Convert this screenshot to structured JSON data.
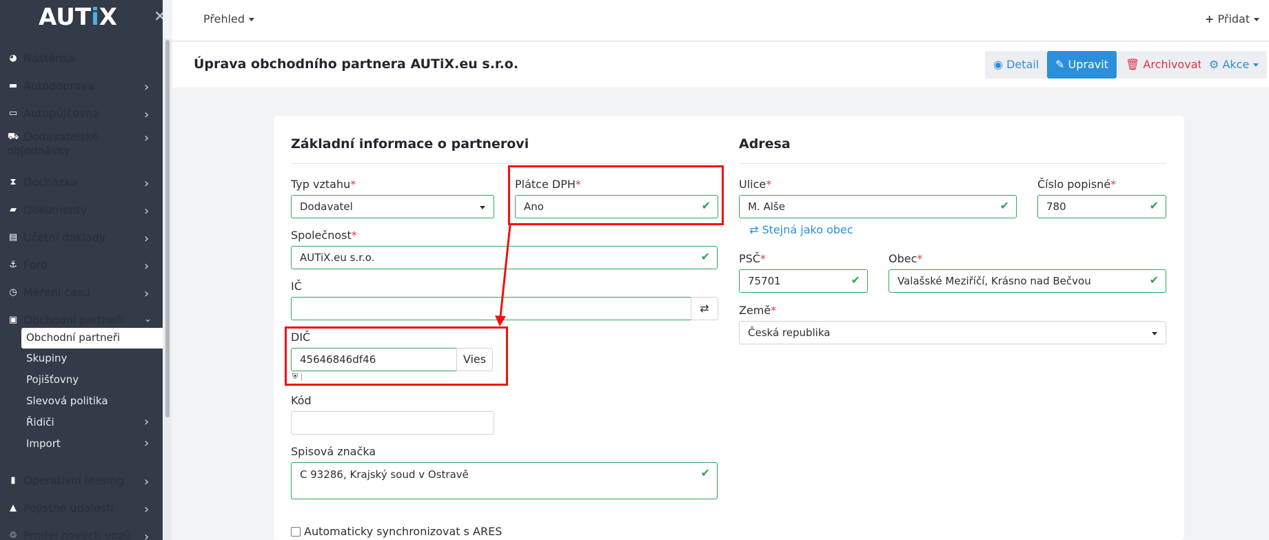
{
  "sidebar": {
    "logo": {
      "pre": "AUT",
      "i": "i",
      "post": "X"
    },
    "items": [
      {
        "label": "Nástěnka",
        "icon": "dashboard-icon",
        "glyph": "◕",
        "chevron": false
      },
      {
        "label": "Autodoprava",
        "icon": "truck-icon",
        "glyph": "▬",
        "chevron": true
      },
      {
        "label": "Autopůjčovna",
        "icon": "id-card-icon",
        "glyph": "▭",
        "chevron": true
      },
      {
        "label": "Dodavatelské",
        "label2": "objednávky",
        "icon": "cart-icon",
        "glyph": "⛟",
        "chevron": true
      },
      {
        "label": "Docházka",
        "icon": "hourglass-icon",
        "glyph": "⧗",
        "chevron": true
      },
      {
        "label": "Dokumenty",
        "icon": "folder-icon",
        "glyph": "▰",
        "chevron": true
      },
      {
        "label": "Účetní doklady",
        "icon": "file-icon",
        "glyph": "▤",
        "chevron": true
      },
      {
        "label": "Ford",
        "icon": "anchor-icon",
        "glyph": "⚓",
        "chevron": true
      },
      {
        "label": "Měření času",
        "icon": "clock-icon",
        "glyph": "◷",
        "chevron": true
      },
      {
        "label": "Obchodní partneři",
        "icon": "briefcase-icon",
        "glyph": "▣",
        "chevron": true,
        "expanded": true
      },
      {
        "label": "Operativní leasing",
        "icon": "book-icon",
        "glyph": "▮",
        "chevron": true
      },
      {
        "label": "Pojistné události",
        "icon": "warning-icon",
        "glyph": "▲",
        "chevron": true
      },
      {
        "label": "Prodej nových vozů",
        "icon": "handshake-icon",
        "glyph": "♲",
        "chevron": true
      }
    ],
    "subitems": [
      {
        "label": "Obchodní partneři",
        "active": true
      },
      {
        "label": "Skupiny"
      },
      {
        "label": "Pojišťovny"
      },
      {
        "label": "Slevová politika"
      },
      {
        "label": "Řidiči",
        "chevron": true
      },
      {
        "label": "Import",
        "chevron": true
      }
    ]
  },
  "topbar": {
    "overview": "Přehled",
    "add": "Přidat"
  },
  "title": "Úprava obchodního partnera AUTiX.eu s.r.o.",
  "actions": {
    "detail": "Detail",
    "edit": "Upravit",
    "archive": "Archivovat",
    "more": "Akce"
  },
  "form": {
    "basic_title": "Základní informace o partnerovi",
    "typ_label": "Typ vztahu",
    "typ_value": "Dodavatel",
    "platce_label": "Plátce DPH",
    "platce_value": "Ano",
    "spolecnost_label": "Společnost",
    "spolecnost_value": "AUTiX.eu s.r.o.",
    "ic_label": "IČ",
    "ic_value": "",
    "dic_label": "DIČ",
    "dic_value": "45646846df46",
    "vies_label": "Vies",
    "kod_label": "Kód",
    "kod_value": "",
    "spis_label": "Spisová značka",
    "spis_value": "C 93286, Krajský soud v Ostravě",
    "ares_label": "Automaticky synchronizovat s ARES",
    "required_mark": "*"
  },
  "address": {
    "title": "Adresa",
    "ulice_label": "Ulice",
    "ulice_value": "M. Alše",
    "cislo_label": "Číslo popisné",
    "cislo_value": "780",
    "same_link": "Stejná jako obec",
    "psc_label": "PSČ",
    "psc_value": "75701",
    "obec_label": "Obec",
    "obec_value": "Valašské Meziříčí, Krásno nad Bečvou",
    "zeme_label": "Země",
    "zeme_value": "Česká republika"
  },
  "colors": {
    "sidebar": "#333a48",
    "accent": "#2a90db",
    "valid": "#2fa35d",
    "danger": "#dd3344",
    "annotation": "#ee1111"
  }
}
